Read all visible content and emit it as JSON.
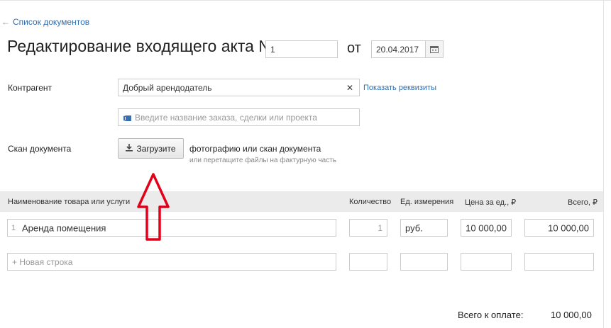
{
  "nav": {
    "back_arrow": "←",
    "back_label": "Список документов"
  },
  "header": {
    "title": "Редактирование входящего акта №",
    "number": "1",
    "date_label": "от",
    "date": "20.04.2017"
  },
  "counterparty": {
    "label": "Контрагент",
    "value": "Добрый арендодатель",
    "clear_glyph": "✕",
    "details_link": "Показать реквизиты",
    "project_placeholder": "Введите название заказа, сделки или проекта"
  },
  "scan": {
    "label": "Скан документа",
    "button_label": "Загрузите",
    "hint": "фотографию или скан документа",
    "subhint": "или перетащите файлы на фактурную часть"
  },
  "table": {
    "headers": {
      "name": "Наименование товара или услуги",
      "qty": "Количество",
      "unit": "Ед. измерения",
      "price": "Цена за ед., ₽",
      "total": "Всего, ₽"
    },
    "rows": [
      {
        "num": "1",
        "name": "Аренда помещения",
        "qty": "1",
        "unit": "руб.",
        "price": "10 000,00",
        "total": "10 000,00"
      }
    ],
    "new_row_placeholder": "+ Новая строка"
  },
  "summary": {
    "label": "Всего к оплате:",
    "value": "10 000,00"
  },
  "annotation": {
    "arrow_color": "#e2001a",
    "arrow_direction": "up"
  },
  "icons": [
    "calendar-icon",
    "clear-icon",
    "project-icon",
    "upload-icon"
  ]
}
